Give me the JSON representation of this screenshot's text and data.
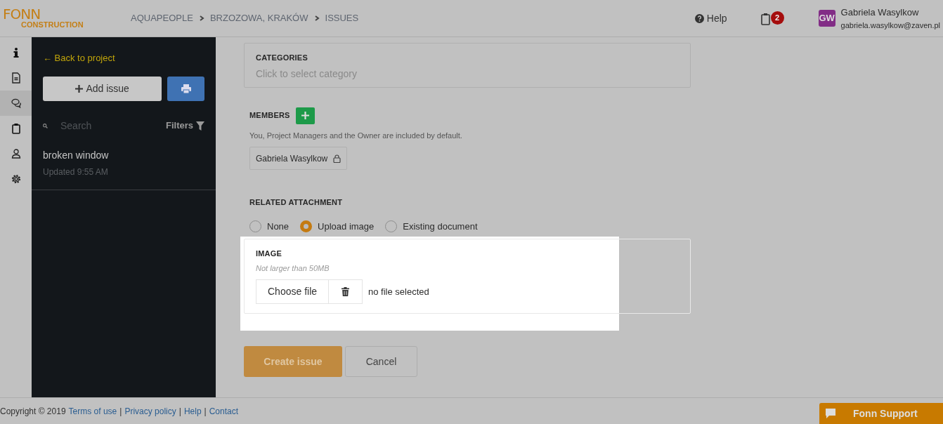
{
  "logo": {
    "line1": "FONN",
    "line2": "CONSTRUCTION"
  },
  "breadcrumb": [
    "AQUAPEOPLE",
    "BRZOZOWA, KRAKÓW",
    "ISSUES"
  ],
  "header": {
    "help": "Help",
    "tasks_count": "2",
    "user": {
      "initials": "GW",
      "name": "Gabriela Wasylkow",
      "email": "gabriela.wasylkow@zaven.pl"
    }
  },
  "rail": [
    {
      "kind": "info",
      "selected": false
    },
    {
      "kind": "document",
      "selected": false
    },
    {
      "kind": "chat",
      "selected": true
    },
    {
      "kind": "clipboard",
      "selected": false
    },
    {
      "kind": "person",
      "selected": false
    },
    {
      "kind": "gear",
      "selected": false
    }
  ],
  "sidebar": {
    "back": "← Back to project",
    "add_button": "Add issue",
    "search": {
      "placeholder": "Search"
    },
    "filters": "Filters",
    "issues": [
      {
        "title": "broken window",
        "updated": "Updated 9:55 AM"
      }
    ]
  },
  "form": {
    "categories": {
      "label": "CATEGORIES",
      "placeholder": "Click to select category"
    },
    "members": {
      "label": "MEMBERS",
      "note": "You, Project Managers and the Owner are included by default.",
      "chips": [
        {
          "name": "Gabriela Wasylkow",
          "locked": true
        }
      ]
    },
    "attachment": {
      "label": "RELATED ATTACHMENT",
      "options": [
        {
          "label": "None",
          "selected": false
        },
        {
          "label": "Upload image",
          "selected": true
        },
        {
          "label": "Existing document",
          "selected": false
        }
      ]
    },
    "image": {
      "label": "IMAGE",
      "hint": "Not larger than 50MB",
      "choose": "Choose file",
      "status": "no file selected",
      "highlighted": true
    },
    "buttons": {
      "create": "Create issue",
      "cancel": "Cancel"
    }
  },
  "footer": {
    "items": [
      {
        "kind": "text",
        "text": "Copyright © 2019"
      },
      {
        "kind": "link",
        "text": "Terms of use"
      },
      {
        "kind": "text",
        "text": "|"
      },
      {
        "kind": "link",
        "text": "Privacy policy"
      },
      {
        "kind": "text",
        "text": "|"
      },
      {
        "kind": "link",
        "text": "Help"
      },
      {
        "kind": "text",
        "text": "|"
      },
      {
        "kind": "link",
        "text": "Contact"
      }
    ],
    "support": "Fonn Support"
  }
}
